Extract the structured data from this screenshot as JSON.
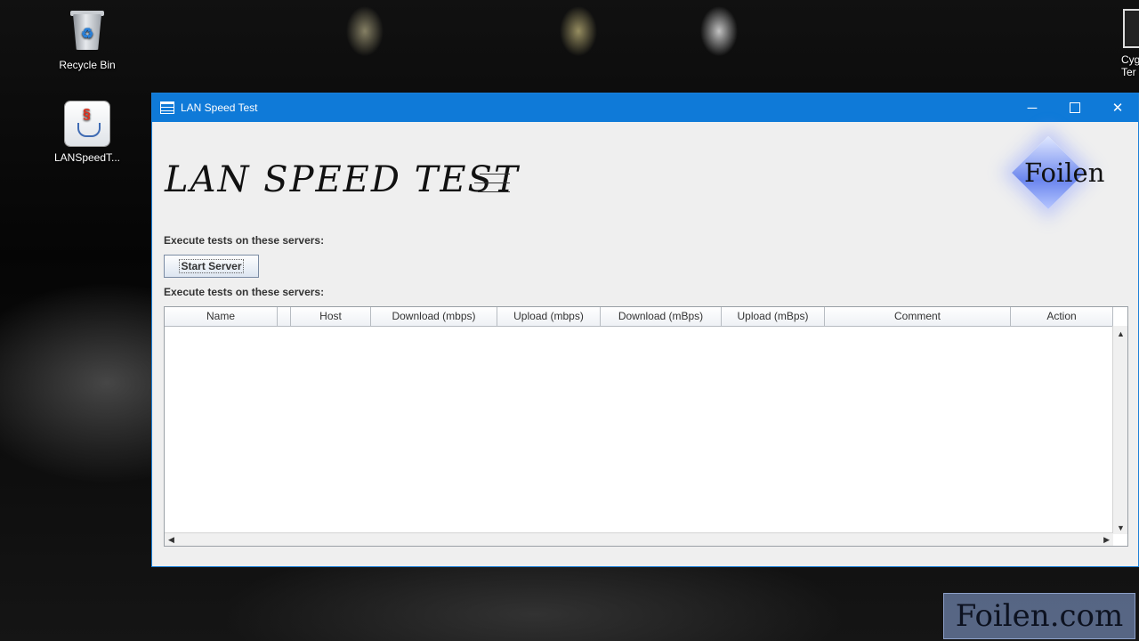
{
  "desktop": {
    "icons": [
      {
        "label": "Recycle Bin"
      },
      {
        "label": "LANSpeedT..."
      }
    ],
    "edge_icon_lines": [
      "Cyg",
      "Ter"
    ]
  },
  "window": {
    "title": "LAN Speed Test",
    "controls": {
      "minimize": "─",
      "close": "✕"
    },
    "heading": "LAN SPEED TEST",
    "logo_text": "Foilen",
    "label_top": "Execute tests on these servers:",
    "start_button": "Start Server",
    "label_table": "Execute tests on these servers:",
    "table": {
      "columns": [
        "Name",
        "",
        "Host",
        "Download (mbps)",
        "Upload (mbps)",
        "Download (mBps)",
        "Upload (mBps)",
        "Comment",
        "Action"
      ],
      "rows": []
    },
    "scroll_arrows": {
      "up": "▲",
      "down": "▼",
      "left": "◀",
      "right": "▶"
    }
  },
  "watermark": "Foilen.com",
  "colors": {
    "titlebar": "#0f7ad8",
    "window_bg": "#efefef"
  }
}
